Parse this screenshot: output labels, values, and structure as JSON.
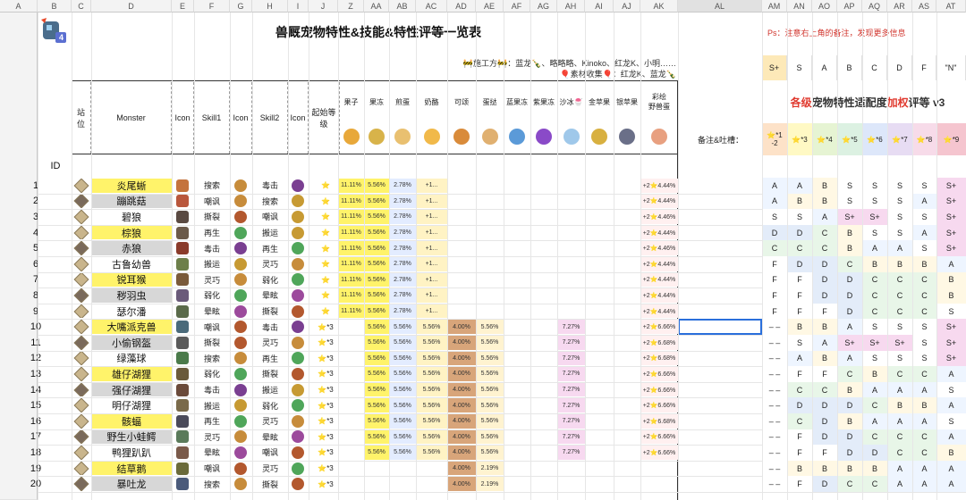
{
  "column_letters": [
    "A",
    "B",
    "C",
    "D",
    "E",
    "F",
    "G",
    "H",
    "I",
    "J",
    "Z",
    "AA",
    "AB",
    "AC",
    "AD",
    "AE",
    "AF",
    "AG",
    "AH",
    "AI",
    "AJ",
    "AK",
    "AL",
    "AM",
    "AN",
    "AO",
    "AP",
    "AQ",
    "AR",
    "AS",
    "AT"
  ],
  "selected_column": "AL",
  "logo_badge": "4",
  "title": "兽厩宠物特性&技能&特性评等一览表",
  "ps_note": "Ps：注意右上角的备注，发现更多信息",
  "credit_line1": "🚧施工方🚧：蓝龙🍾、略略略、Kinoko、红龙K、小明……",
  "credit_line2": "🎈素材收集🎈：红龙K、蓝龙🍾",
  "grade_title_prefix": "各级",
  "grade_title_mid": "宠物特性适配度",
  "grade_title_accent": "加权",
  "grade_title_suffix": "评等 v3",
  "notes_label": "备注&吐槽：",
  "headers": {
    "station": "站\n位",
    "monster": "Monster",
    "icon": "Icon",
    "skill1": "Skill1",
    "icon2": "Icon",
    "skill2": "Skill2",
    "icon3": "Icon",
    "start_level": "起始等级",
    "id": "ID",
    "foods": [
      "果子",
      "果冻",
      "煎蛋",
      "奶酪",
      "可颂",
      "蛋挞",
      "蓝果冻",
      "紫果冻",
      "沙冰🍧",
      "金苹果",
      "银苹果",
      "彩绘\n野兽蛋"
    ]
  },
  "grade_levels": [
    "S+",
    "S",
    "A",
    "B",
    "C",
    "D",
    "F",
    "\"N\""
  ],
  "grade_level_colors": [
    "#fde9b8",
    "#ffffff",
    "#ffffff",
    "#ffffff",
    "#ffffff",
    "#ffffff",
    "#ffffff",
    "#ffffff"
  ],
  "star_headers": [
    "⭐*1\n-2",
    "⭐*3",
    "⭐*4",
    "⭐*5",
    "⭐*6",
    "⭐*7",
    "⭐*8",
    "⭐*9"
  ],
  "star_header_colors": [
    "#fde2c8",
    "#fff9c4",
    "#e6f4d3",
    "#dcf1e2",
    "#dde7fa",
    "#e7dcf3",
    "#f7dbe9",
    "#f5c5cf"
  ],
  "rows": [
    {
      "id": "1",
      "name": "炎尾蜥",
      "nameBg": "#fff36a",
      "st": "#c9b58c",
      "i1": "#c4733d",
      "s1": "搜索",
      "i2": "#c78c3b",
      "s2": "毒击",
      "i3": "#7a3f91",
      "lv": "⭐",
      "f": [
        "11.11%",
        "5.56%",
        "2.78%",
        "+1..."
      ],
      "egg": "+2⭐4.44%",
      "g": [
        "A",
        "A",
        "B",
        "S",
        "S",
        "S",
        "S",
        "S+"
      ]
    },
    {
      "id": "2",
      "name": "蹦跳菇",
      "nameBg": "#d7d7d7",
      "st": "#7a6a5b",
      "i1": "#b9573c",
      "s1": "嘲讽",
      "i2": "#c78c3b",
      "s2": "搜索",
      "i3": "#c79a33",
      "lv": "⭐",
      "f": [
        "11.11%",
        "5.56%",
        "2.78%",
        "+1..."
      ],
      "egg": "+2⭐4.44%",
      "g": [
        "A",
        "B",
        "B",
        "S",
        "S",
        "S",
        "A",
        "S+"
      ]
    },
    {
      "id": "3",
      "name": "碧狼",
      "nameBg": "#ffffff",
      "st": "#c9b58c",
      "i1": "#5a4a42",
      "s1": "撕裂",
      "i2": "#b3582e",
      "s2": "嘲讽",
      "i3": "#c79a33",
      "lv": "⭐",
      "f": [
        "11.11%",
        "5.56%",
        "2.78%",
        "+1..."
      ],
      "egg": "+2⭐4.46%",
      "g": [
        "S",
        "S",
        "A",
        "S+",
        "S+",
        "S",
        "S",
        "S+"
      ]
    },
    {
      "id": "4",
      "name": "棕狼",
      "nameBg": "#fff36a",
      "st": "#c9b58c",
      "i1": "#6b5a4a",
      "s1": "再生",
      "i2": "#4fa65a",
      "s2": "搬运",
      "i3": "#c79a33",
      "lv": "⭐",
      "f": [
        "11.11%",
        "5.56%",
        "2.78%",
        "+1..."
      ],
      "egg": "+2⭐4.44%",
      "g": [
        "D",
        "D",
        "C",
        "B",
        "S",
        "S",
        "A",
        "S+"
      ]
    },
    {
      "id": "5",
      "name": "赤狼",
      "nameBg": "#d7d7d7",
      "st": "#7a6a5b",
      "i1": "#8a3a2a",
      "s1": "毒击",
      "i2": "#7a3f91",
      "s2": "再生",
      "i3": "#4fa65a",
      "lv": "⭐",
      "f": [
        "11.11%",
        "5.56%",
        "2.78%",
        "+1..."
      ],
      "egg": "+2⭐4.46%",
      "g": [
        "C",
        "C",
        "C",
        "B",
        "A",
        "A",
        "S",
        "S+"
      ]
    },
    {
      "id": "6",
      "name": "古鲁幼兽",
      "nameBg": "#ffffff",
      "st": "#c9b58c",
      "i1": "#6d7f4a",
      "s1": "搬运",
      "i2": "#c79a33",
      "s2": "灵巧",
      "i3": "#c78c3b",
      "lv": "⭐",
      "f": [
        "11.11%",
        "5.56%",
        "2.78%",
        "+1..."
      ],
      "egg": "+2⭐4.44%",
      "g": [
        "F",
        "D",
        "D",
        "C",
        "B",
        "B",
        "B",
        "A"
      ]
    },
    {
      "id": "7",
      "name": "锐耳猴",
      "nameBg": "#fff36a",
      "st": "#c9b58c",
      "i1": "#7a5a3a",
      "s1": "灵巧",
      "i2": "#c78c3b",
      "s2": "弱化",
      "i3": "#4fa65a",
      "lv": "⭐",
      "f": [
        "11.11%",
        "5.56%",
        "2.78%",
        "+1..."
      ],
      "egg": "+2⭐4.44%",
      "g": [
        "F",
        "F",
        "D",
        "D",
        "C",
        "C",
        "C",
        "B"
      ]
    },
    {
      "id": "8",
      "name": "秽羽虫",
      "nameBg": "#d7d7d7",
      "st": "#7a6a5b",
      "i1": "#6a5a7a",
      "s1": "弱化",
      "i2": "#4fa65a",
      "s2": "晕眩",
      "i3": "#9c4a9c",
      "lv": "⭐",
      "f": [
        "11.11%",
        "5.56%",
        "2.78%",
        "+1..."
      ],
      "egg": "+2⭐4.44%",
      "g": [
        "F",
        "F",
        "D",
        "D",
        "C",
        "C",
        "C",
        "B"
      ]
    },
    {
      "id": "9",
      "name": "瑟尔潘",
      "nameBg": "#ffffff",
      "st": "#c9b58c",
      "i1": "#5a6a4a",
      "s1": "晕眩",
      "i2": "#9c4a9c",
      "s2": "撕裂",
      "i3": "#b3582e",
      "lv": "⭐",
      "f": [
        "11.11%",
        "5.56%",
        "2.78%",
        "+1..."
      ],
      "egg": "+2⭐4.44%",
      "g": [
        "F",
        "F",
        "F",
        "D",
        "C",
        "C",
        "C",
        "S"
      ]
    },
    {
      "id": "10",
      "name": "大嘴派克兽",
      "nameBg": "#fff36a",
      "st": "#c9b58c",
      "i1": "#4a6a7a",
      "s1": "嘲讽",
      "i2": "#b3582e",
      "s2": "毒击",
      "i3": "#7a3f91",
      "lv": "⭐*3",
      "f": [
        "",
        "5.56%",
        "5.56%",
        "5.56%",
        "4.00%",
        "5.56%",
        "",
        "",
        "7.27%"
      ],
      "egg": "+2⭐6.66%",
      "g": [
        "– –",
        "B",
        "B",
        "A",
        "S",
        "S",
        "S",
        "S+"
      ]
    },
    {
      "id": "11",
      "name": "小偷钢盔",
      "nameBg": "#d7d7d7",
      "st": "#7a6a5b",
      "i1": "#5a5a5a",
      "s1": "撕裂",
      "i2": "#b3582e",
      "s2": "灵巧",
      "i3": "#c78c3b",
      "lv": "⭐*3",
      "f": [
        "",
        "5.56%",
        "5.56%",
        "5.56%",
        "4.00%",
        "5.56%",
        "",
        "",
        "7.27%"
      ],
      "egg": "+2⭐6.68%",
      "g": [
        "– –",
        "S",
        "A",
        "S+",
        "S+",
        "S+",
        "S",
        "S+"
      ]
    },
    {
      "id": "12",
      "name": "绿藻球",
      "nameBg": "#ffffff",
      "st": "#c9b58c",
      "i1": "#4a7a4a",
      "s1": "搜索",
      "i2": "#c78c3b",
      "s2": "再生",
      "i3": "#4fa65a",
      "lv": "⭐*3",
      "f": [
        "",
        "5.56%",
        "5.56%",
        "5.56%",
        "4.00%",
        "5.56%",
        "",
        "",
        "7.27%"
      ],
      "egg": "+2⭐6.68%",
      "g": [
        "– –",
        "A",
        "B",
        "A",
        "S",
        "S",
        "S",
        "S+"
      ]
    },
    {
      "id": "13",
      "name": "雄仔湖狸",
      "nameBg": "#fff36a",
      "st": "#c9b58c",
      "i1": "#6a5a3a",
      "s1": "弱化",
      "i2": "#4fa65a",
      "s2": "撕裂",
      "i3": "#b3582e",
      "lv": "⭐*3",
      "f": [
        "",
        "5.56%",
        "5.56%",
        "5.56%",
        "4.00%",
        "5.56%",
        "",
        "",
        "7.27%"
      ],
      "egg": "+2⭐6.66%",
      "g": [
        "– –",
        "F",
        "F",
        "C",
        "B",
        "C",
        "C",
        "A"
      ]
    },
    {
      "id": "14",
      "name": "强仔湖狸",
      "nameBg": "#d7d7d7",
      "st": "#7a6a5b",
      "i1": "#6a4a3a",
      "s1": "毒击",
      "i2": "#7a3f91",
      "s2": "搬运",
      "i3": "#c79a33",
      "lv": "⭐*3",
      "f": [
        "",
        "5.56%",
        "5.56%",
        "5.56%",
        "4.00%",
        "5.56%",
        "",
        "",
        "7.27%"
      ],
      "egg": "+2⭐6.66%",
      "g": [
        "– –",
        "C",
        "C",
        "B",
        "A",
        "A",
        "A",
        "S"
      ]
    },
    {
      "id": "15",
      "name": "明仔湖狸",
      "nameBg": "#ffffff",
      "st": "#c9b58c",
      "i1": "#7a6a4a",
      "s1": "搬运",
      "i2": "#c79a33",
      "s2": "弱化",
      "i3": "#4fa65a",
      "lv": "⭐*3",
      "f": [
        "",
        "5.56%",
        "5.56%",
        "5.56%",
        "4.00%",
        "5.56%",
        "",
        "",
        "7.27%"
      ],
      "egg": "+2⭐6.66%",
      "g": [
        "– –",
        "D",
        "D",
        "D",
        "C",
        "B",
        "B",
        "A"
      ]
    },
    {
      "id": "16",
      "name": "骸蝠",
      "nameBg": "#fff36a",
      "st": "#c9b58c",
      "i1": "#4a4a5a",
      "s1": "再生",
      "i2": "#4fa65a",
      "s2": "灵巧",
      "i3": "#c78c3b",
      "lv": "⭐*3",
      "f": [
        "",
        "5.56%",
        "5.56%",
        "5.56%",
        "4.00%",
        "5.56%",
        "",
        "",
        "7.27%"
      ],
      "egg": "+2⭐6.68%",
      "g": [
        "– –",
        "C",
        "D",
        "B",
        "A",
        "A",
        "A",
        "S"
      ]
    },
    {
      "id": "17",
      "name": "野生小蛙鳄",
      "nameBg": "#d7d7d7",
      "st": "#7a6a5b",
      "i1": "#5a7a5a",
      "s1": "灵巧",
      "i2": "#c78c3b",
      "s2": "晕眩",
      "i3": "#9c4a9c",
      "lv": "⭐*3",
      "f": [
        "",
        "5.56%",
        "5.56%",
        "5.56%",
        "4.00%",
        "5.56%",
        "",
        "",
        "7.27%"
      ],
      "egg": "+2⭐6.66%",
      "g": [
        "– –",
        "F",
        "D",
        "D",
        "C",
        "C",
        "C",
        "A"
      ]
    },
    {
      "id": "18",
      "name": "鸭狸趴趴",
      "nameBg": "#ffffff",
      "st": "#c9b58c",
      "i1": "#7a5a4a",
      "s1": "晕眩",
      "i2": "#9c4a9c",
      "s2": "嘲讽",
      "i3": "#b3582e",
      "lv": "⭐*3",
      "f": [
        "",
        "5.56%",
        "5.56%",
        "5.56%",
        "4.00%",
        "5.56%",
        "",
        "",
        "7.27%"
      ],
      "egg": "+2⭐6.66%",
      "g": [
        "– –",
        "F",
        "F",
        "D",
        "D",
        "C",
        "C",
        "B"
      ]
    },
    {
      "id": "19",
      "name": "结草鹅",
      "nameBg": "#fff36a",
      "st": "#c9b58c",
      "i1": "#6a6a3a",
      "s1": "嘲讽",
      "i2": "#b3582e",
      "s2": "灵巧",
      "i3": "#4fa65a",
      "lv": "⭐*3",
      "f": [
        "",
        "",
        "",
        "",
        "4.00%",
        "2.19%"
      ],
      "egg": "",
      "g": [
        "– –",
        "B",
        "B",
        "B",
        "B",
        "A",
        "A",
        "A"
      ]
    },
    {
      "id": "20",
      "name": "暴吐龙",
      "nameBg": "#d7d7d7",
      "st": "#7a6a5b",
      "i1": "#4a5a7a",
      "s1": "搜索",
      "i2": "#c78c3b",
      "s2": "撕裂",
      "i3": "#b3582e",
      "lv": "⭐*3",
      "f": [
        "",
        "",
        "",
        "",
        "4.00%",
        "2.19%"
      ],
      "egg": "",
      "g": [
        "– –",
        "F",
        "D",
        "C",
        "C",
        "A",
        "A",
        "A"
      ]
    }
  ]
}
